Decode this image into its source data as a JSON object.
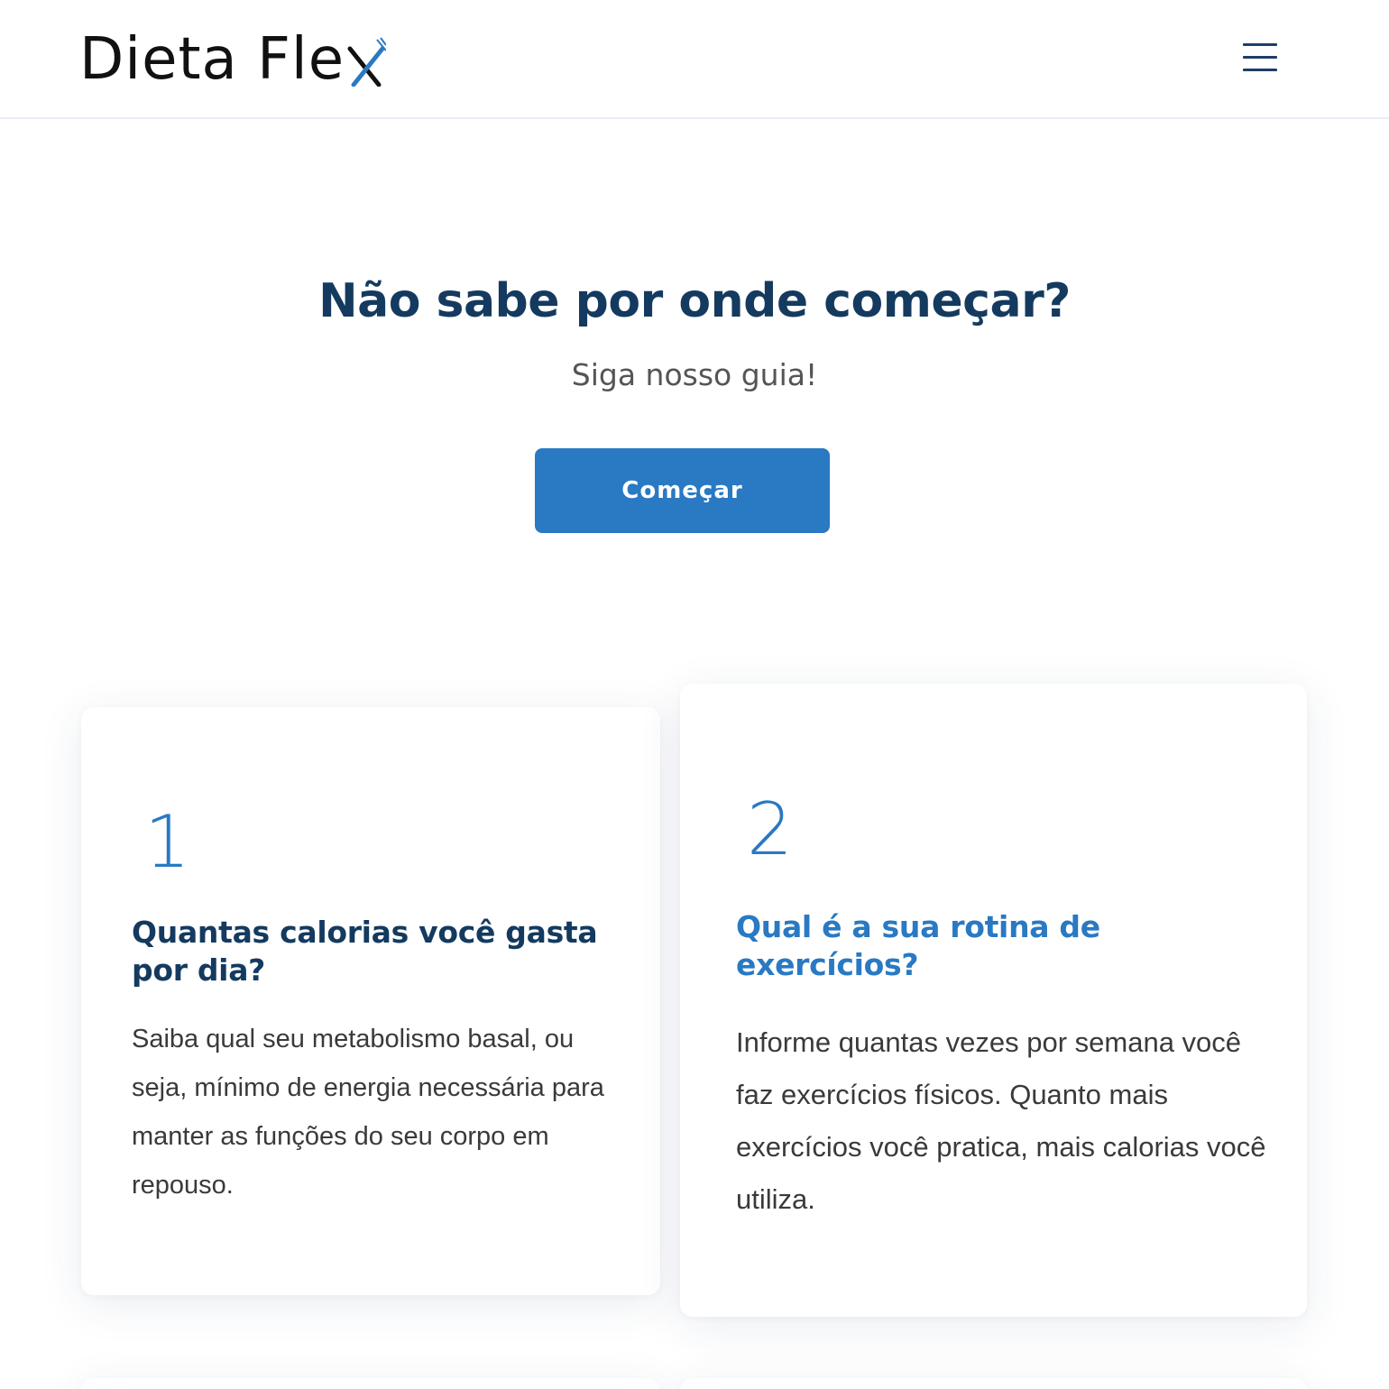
{
  "header": {
    "logo_text": "Dieta Fle",
    "logo_mark_letter": "x",
    "menu_icon": "hamburger-menu-icon"
  },
  "hero": {
    "title": "Não sabe por onde começar?",
    "subtitle": "Siga nosso guia!",
    "cta_label": "Começar"
  },
  "steps": [
    {
      "number": "1",
      "title": "Quantas calorias você gasta por dia?",
      "text": "Saiba qual seu metabolismo basal, ou seja, mínimo de energia necessária para manter as funções do seu corpo em repouso."
    },
    {
      "number": "2",
      "title": "Qual é a sua rotina de exercícios?",
      "text": "Informe quantas vezes por semana você faz exercícios físicos. Quanto mais exercícios você pratica, mais calorias você utiliza."
    }
  ],
  "colors": {
    "accent": "#2979c3",
    "heading": "#143a5f",
    "text": "#3a3a3a"
  }
}
